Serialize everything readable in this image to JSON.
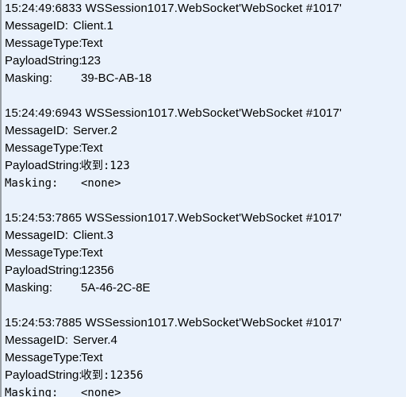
{
  "panel": {
    "background_color": "#eaf2fc",
    "border_color": "#9aa0a6",
    "text_color": "#000000"
  },
  "labels": {
    "message_id": "MessageID:",
    "message_type": "MessageType:",
    "payload_string": "PayloadString:",
    "masking": "Masking:"
  },
  "blocks": [
    {
      "header": "15:24:49:6833 WSSession1017.WebSocket'WebSocket #1017'",
      "timestamp": "15:24:49:6833",
      "session": "WSSession1017.WebSocket'WebSocket #1017'",
      "message_id": "Client.1",
      "message_type": "Text",
      "payload_string": "123",
      "masking": "39-BC-AB-18",
      "masking_mono": false,
      "payload_mono": false
    },
    {
      "header": "15:24:49:6943 WSSession1017.WebSocket'WebSocket #1017'",
      "timestamp": "15:24:49:6943",
      "session": "WSSession1017.WebSocket'WebSocket #1017'",
      "message_id": "Server.2",
      "message_type": "Text",
      "payload_string": "收到:123",
      "masking": "<none>",
      "masking_mono": true,
      "payload_mono": true
    },
    {
      "header": "15:24:53:7865 WSSession1017.WebSocket'WebSocket #1017'",
      "timestamp": "15:24:53:7865",
      "session": "WSSession1017.WebSocket'WebSocket #1017'",
      "message_id": "Client.3",
      "message_type": "Text",
      "payload_string": "12356",
      "masking": "5A-46-2C-8E",
      "masking_mono": false,
      "payload_mono": false
    },
    {
      "header": "15:24:53:7885 WSSession1017.WebSocket'WebSocket #1017'",
      "timestamp": "15:24:53:7885",
      "session": "WSSession1017.WebSocket'WebSocket #1017'",
      "message_id": "Server.4",
      "message_type": "Text",
      "payload_string": "收到:12356",
      "masking": "<none>",
      "masking_mono": true,
      "payload_mono": true
    }
  ]
}
